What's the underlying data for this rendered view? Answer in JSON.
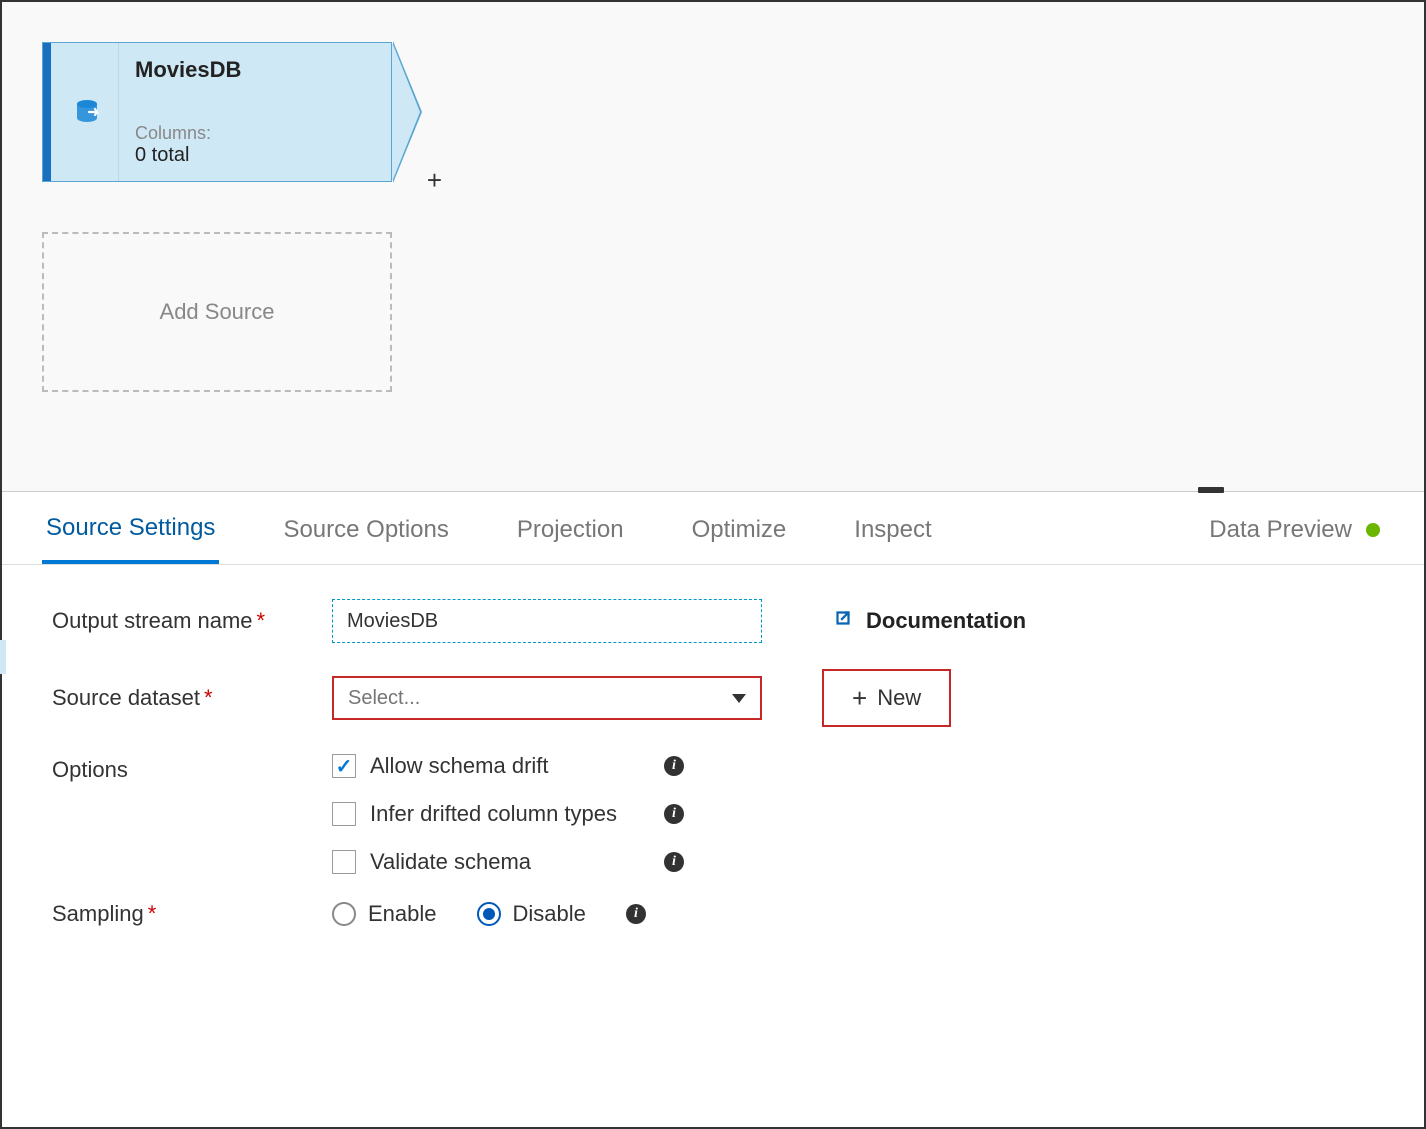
{
  "canvas": {
    "source_node": {
      "title": "MoviesDB",
      "columns_label": "Columns:",
      "columns_value": "0 total"
    },
    "add_source_label": "Add Source",
    "plus_label": "+"
  },
  "tabs": [
    {
      "label": "Source Settings",
      "active": true
    },
    {
      "label": "Source Options",
      "active": false
    },
    {
      "label": "Projection",
      "active": false
    },
    {
      "label": "Optimize",
      "active": false
    },
    {
      "label": "Inspect",
      "active": false
    }
  ],
  "preview_tab": {
    "label": "Data Preview",
    "status": "green"
  },
  "form": {
    "output_stream": {
      "label": "Output stream name",
      "required": true,
      "value": "MoviesDB"
    },
    "source_dataset": {
      "label": "Source dataset",
      "required": true,
      "placeholder": "Select..."
    },
    "documentation_label": "Documentation",
    "new_button_label": "New",
    "options_label": "Options",
    "options": [
      {
        "label": "Allow schema drift",
        "checked": true
      },
      {
        "label": "Infer drifted column types",
        "checked": false
      },
      {
        "label": "Validate schema",
        "checked": false
      }
    ],
    "sampling": {
      "label": "Sampling",
      "required": true,
      "enable_label": "Enable",
      "disable_label": "Disable",
      "selected": "Disable"
    }
  }
}
